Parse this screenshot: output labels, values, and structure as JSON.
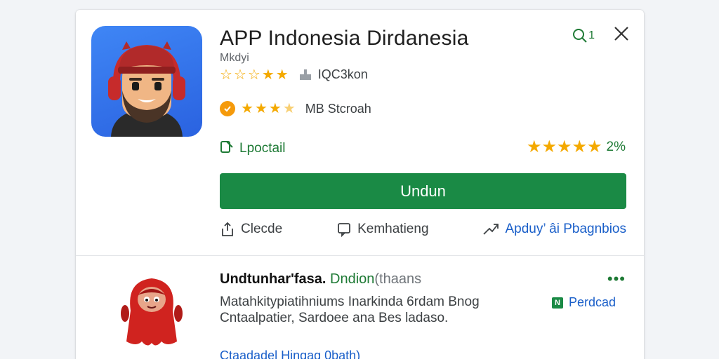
{
  "app": {
    "title": "APP Indonesia Dirdanesia",
    "subtitle": "Mkdyi",
    "rating_line1": "IQC3kon",
    "rating_line2": "MB Stcroah",
    "install_label": "Lpoctail",
    "rating_pct": "2%",
    "install_button": "Undun",
    "actions": {
      "share": "Clecde",
      "feedback": "Kemhatieng",
      "open": "Apduy’ âi Pbagnbios"
    },
    "search_badge": "1"
  },
  "section2": {
    "title_bold": "Undtunhar'fasa.",
    "title_dev": "Dndion",
    "title_muted": "(thaans",
    "desc": "Matahkitypiatihniums Inarkinda 6rdam Bnog Cntaalpatier, Sardoee ana Bes ladaso.",
    "link_label": "Perdcad",
    "footer_link": "Ctaadadel Hingag 0bath)"
  },
  "colors": {
    "accent_green": "#1a8a45",
    "star": "#f4a900",
    "link_blue": "#1a5fc9",
    "icon_bg": "#3f86f5"
  },
  "icons": [
    "search-icon",
    "close-icon",
    "share-icon",
    "feedback-icon",
    "open-icon",
    "install-icon",
    "more-icon"
  ]
}
